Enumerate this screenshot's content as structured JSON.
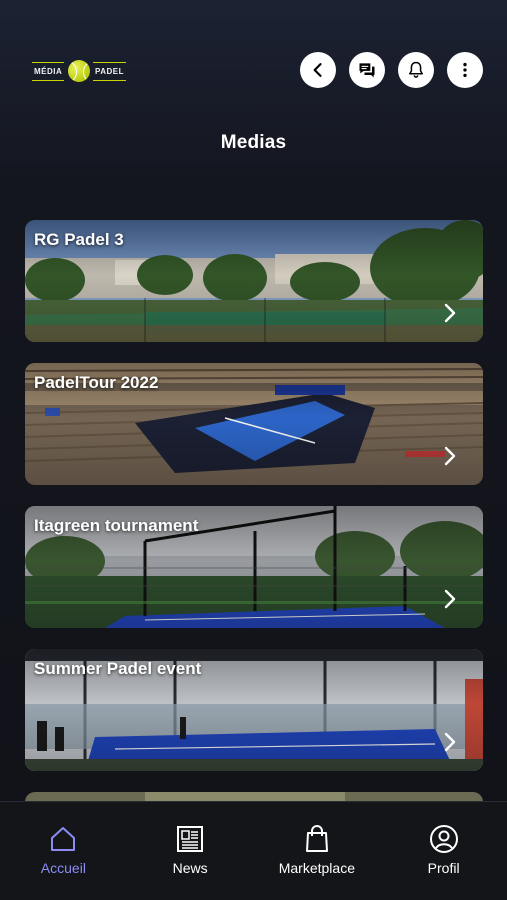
{
  "logo": {
    "left_word": "MÉDIA",
    "right_word": "PADEL"
  },
  "header": {
    "title": "Medias",
    "actions": [
      "back-icon",
      "chat-icon",
      "bell-icon",
      "more-icon"
    ]
  },
  "medias": [
    {
      "title": "RG Padel 3",
      "scene": "palm-courts"
    },
    {
      "title": "PadelTour 2022",
      "scene": "stadium"
    },
    {
      "title": "Itagreen tournament",
      "scene": "cage-court"
    },
    {
      "title": "Summer Padel event",
      "scene": "indoor-court"
    }
  ],
  "nav": {
    "items": [
      {
        "label": "Accueil",
        "icon": "home-icon",
        "active": true
      },
      {
        "label": "News",
        "icon": "newspaper-icon",
        "active": false
      },
      {
        "label": "Marketplace",
        "icon": "shopping-bag-icon",
        "active": false
      },
      {
        "label": "Profil",
        "icon": "user-icon",
        "active": false
      }
    ]
  },
  "colors": {
    "accent": "#8b8cf5",
    "court_blue": "#2f55d8",
    "background": "#111218"
  }
}
